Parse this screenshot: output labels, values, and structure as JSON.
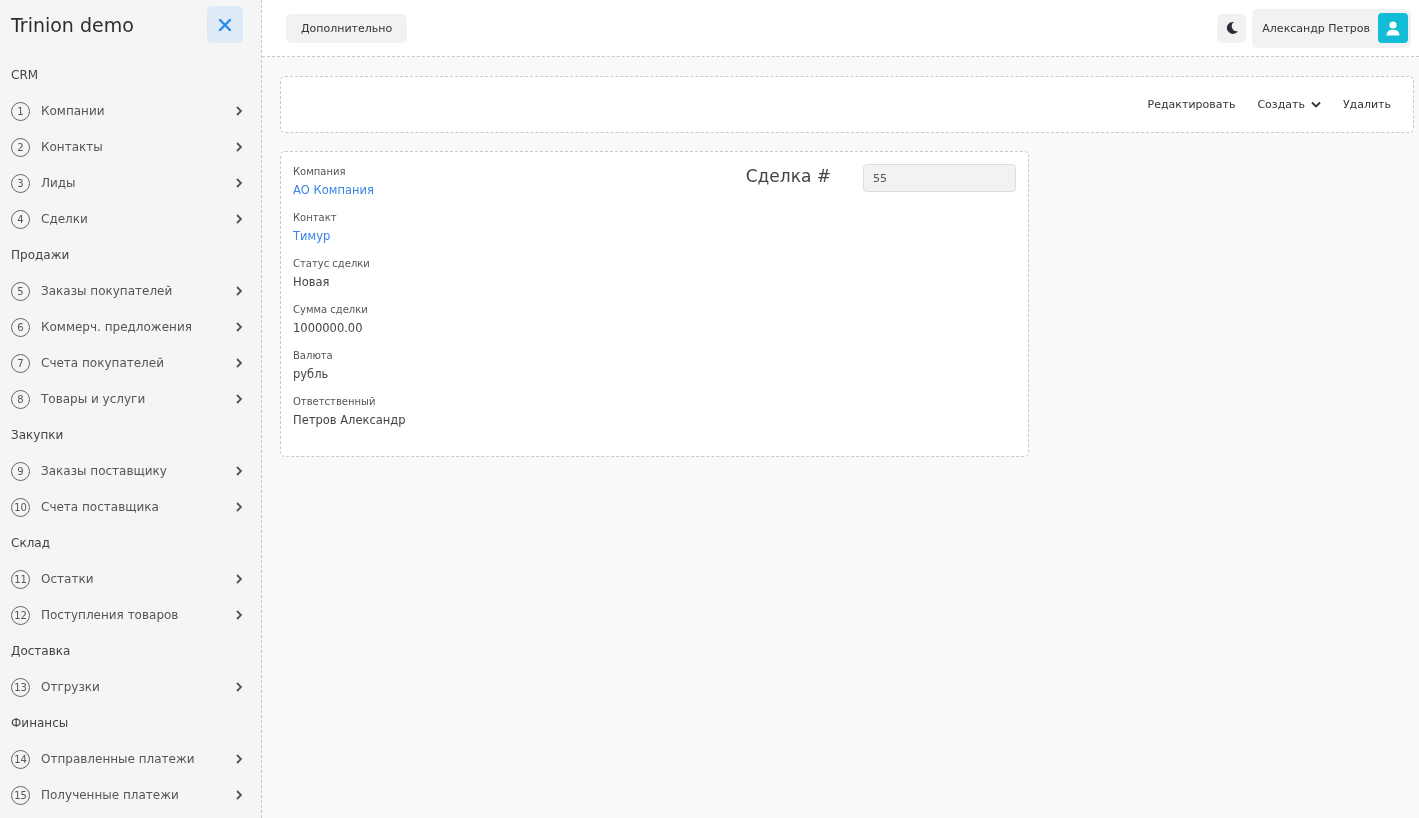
{
  "sidebar": {
    "title": "Trinion demo",
    "sections": [
      {
        "title": "CRM",
        "items": [
          {
            "number": "1",
            "label": "Компании"
          },
          {
            "number": "2",
            "label": "Контакты"
          },
          {
            "number": "3",
            "label": "Лиды"
          },
          {
            "number": "4",
            "label": "Сделки"
          }
        ]
      },
      {
        "title": "Продажи",
        "items": [
          {
            "number": "5",
            "label": "Заказы покупателей"
          },
          {
            "number": "6",
            "label": "Коммерч. предложения"
          },
          {
            "number": "7",
            "label": "Счета покупателей"
          },
          {
            "number": "8",
            "label": "Товары и услуги"
          }
        ]
      },
      {
        "title": "Закупки",
        "items": [
          {
            "number": "9",
            "label": "Заказы поставщику"
          },
          {
            "number": "10",
            "label": "Счета поставщика"
          }
        ]
      },
      {
        "title": "Склад",
        "items": [
          {
            "number": "11",
            "label": "Остатки"
          },
          {
            "number": "12",
            "label": "Поступления товаров"
          }
        ]
      },
      {
        "title": "Доставка",
        "items": [
          {
            "number": "13",
            "label": "Отгрузки"
          }
        ]
      },
      {
        "title": "Финансы",
        "items": [
          {
            "number": "14",
            "label": "Отправленные платежи"
          },
          {
            "number": "15",
            "label": "Полученные платежи"
          }
        ]
      }
    ]
  },
  "header": {
    "button": "Дополнительно",
    "user": "Александр Петров"
  },
  "toolbar": [
    {
      "label": "Редактировать",
      "kind": "plain"
    },
    {
      "label": "Создать",
      "kind": "dropdown"
    },
    {
      "label": "Удалить",
      "kind": "plain"
    }
  ],
  "record": {
    "title": "Сделка #",
    "number": "55",
    "fields": [
      {
        "label": "Компания",
        "value": "АО Компания",
        "kind": "link"
      },
      {
        "label": "Контакт",
        "value": "Тимур",
        "kind": "link"
      },
      {
        "label": "Статус сделки",
        "value": "Новая",
        "kind": "text"
      },
      {
        "label": "Сумма сделки",
        "value": "1000000.00",
        "kind": "text"
      },
      {
        "label": "Валюта",
        "value": "рубль",
        "kind": "text"
      },
      {
        "label": "Ответственный",
        "value": "Петров Александр",
        "kind": "text"
      }
    ]
  }
}
